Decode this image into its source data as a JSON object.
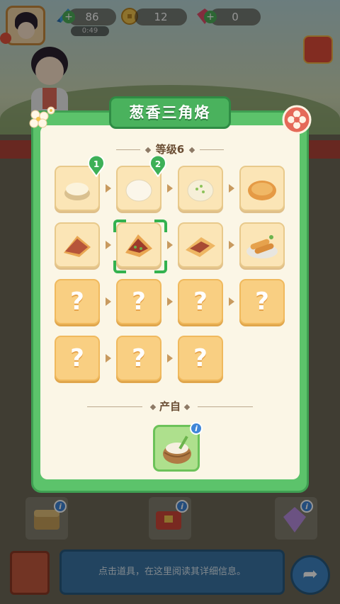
{
  "hud": {
    "energy": "86",
    "energy_timer": "0:49",
    "coins": "12",
    "gems": "0"
  },
  "panel": {
    "title": "葱香三角烙",
    "level_label": "等级6",
    "produced_by_label": "产自",
    "chain": [
      {
        "state": "known",
        "food": "dough-bowl-icon",
        "badge": "1"
      },
      {
        "state": "known",
        "food": "steamed-bun-icon",
        "badge": "2"
      },
      {
        "state": "known",
        "food": "scallion-bun-icon",
        "badge": ""
      },
      {
        "state": "known",
        "food": "pancake-icon",
        "badge": ""
      },
      {
        "state": "known",
        "food": "folded-pancake-icon",
        "badge": ""
      },
      {
        "state": "selected",
        "food": "scallion-triangle-pancake-icon",
        "badge": ""
      },
      {
        "state": "known",
        "food": "stuffed-pancake-icon",
        "badge": ""
      },
      {
        "state": "known",
        "food": "spring-rolls-platter-icon",
        "badge": ""
      },
      {
        "state": "unknown",
        "food": "",
        "badge": ""
      },
      {
        "state": "unknown",
        "food": "",
        "badge": ""
      },
      {
        "state": "unknown",
        "food": "",
        "badge": ""
      },
      {
        "state": "unknown",
        "food": "",
        "badge": ""
      },
      {
        "state": "unknown",
        "food": "",
        "badge": ""
      },
      {
        "state": "unknown",
        "food": "",
        "badge": ""
      },
      {
        "state": "unknown",
        "food": "",
        "badge": ""
      }
    ],
    "unknown_mark": "?",
    "source_item": "flour-basket-icon"
  },
  "bottom": {
    "hint": "点击道具，在这里阅读其详细信息。"
  },
  "colors": {
    "panel_green": "#5cc36b",
    "title_green": "#4ab25d",
    "unknown_tile": "#f9cf82",
    "known_tile": "#fbe5b6",
    "select_green": "#33b24f",
    "hint_blue": "#3b76a6"
  }
}
